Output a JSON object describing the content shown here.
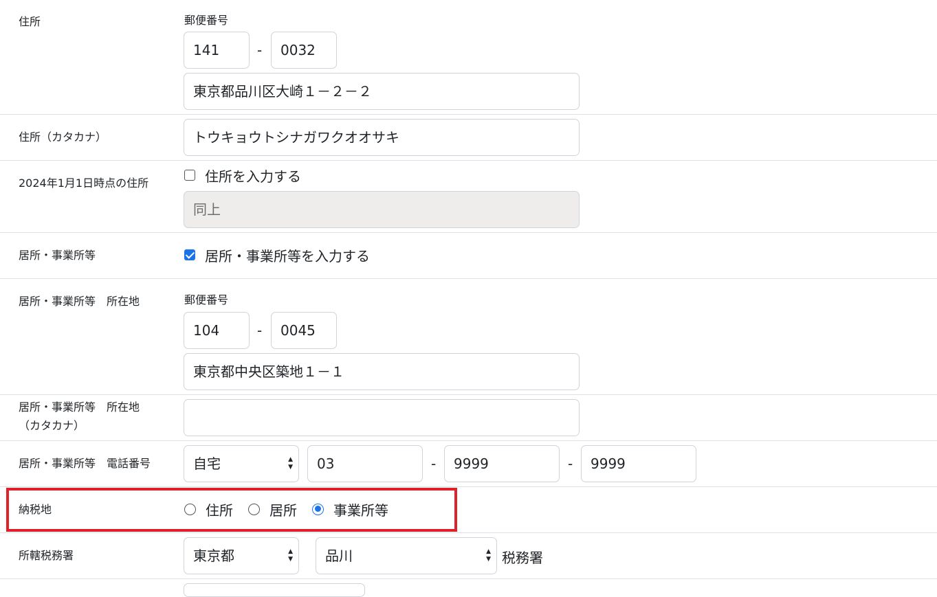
{
  "address": {
    "label": "住所",
    "postal_label": "郵便番号",
    "postal1": "141",
    "postal2": "0032",
    "dash": "-",
    "line": "東京都品川区大崎１－２－２"
  },
  "address_kana": {
    "label": "住所（カタカナ）",
    "value": "トウキョウトシナガワクオオサキ"
  },
  "jan1_address": {
    "label": "2024年1月1日時点の住所",
    "checkbox_label": "住所を入力する",
    "checked": false,
    "value": "同上"
  },
  "residence": {
    "label": "居所・事業所等",
    "checkbox_label": "居所・事業所等を入力する",
    "checked": true
  },
  "residence_location": {
    "label": "居所・事業所等　所在地",
    "postal_label": "郵便番号",
    "postal1": "104",
    "postal2": "0045",
    "dash": "-",
    "line": "東京都中央区築地１－１"
  },
  "residence_kana": {
    "label_line1": "居所・事業所等　所在地",
    "label_line2": "（カタカナ）",
    "value": ""
  },
  "residence_phone": {
    "label": "居所・事業所等　電話番号",
    "type": "自宅",
    "part1": "03",
    "part2": "9999",
    "part3": "9999",
    "dash": "-"
  },
  "tax_place": {
    "label": "納税地",
    "options": [
      "住所",
      "居所",
      "事業所等"
    ],
    "selected": "事業所等",
    "highlight_color": "#e0202a"
  },
  "tax_office": {
    "label": "所轄税務署",
    "prefecture": "東京都",
    "office": "品川",
    "suffix": "税務署"
  },
  "icons": {
    "select_caret": "up-down-caret-icon"
  },
  "colors": {
    "accent": "#1a73e8",
    "border": "#ced4da",
    "disabled_bg": "#eeedeb"
  }
}
